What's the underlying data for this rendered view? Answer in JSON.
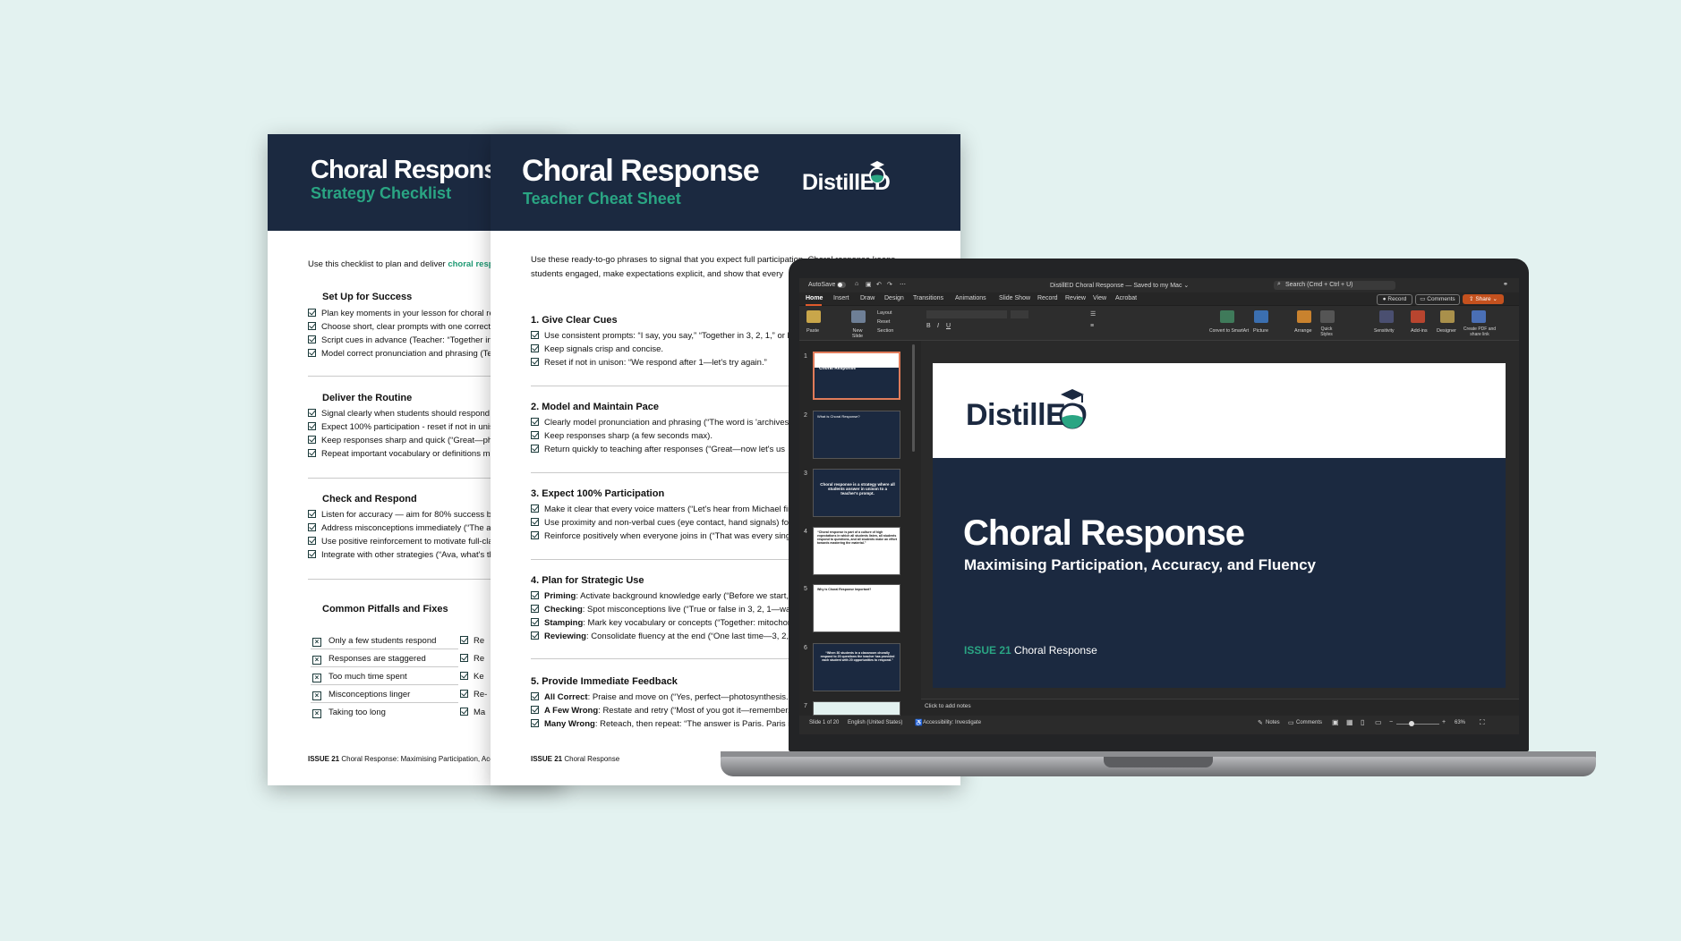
{
  "checklist": {
    "title": "Choral Respons",
    "subtitle": "Strategy Checklist",
    "intro_a": "Use this checklist to plan and deliver ",
    "intro_b": "choral resp",
    "sections": [
      {
        "title": "Set Up for Success",
        "items": [
          "Plan key moments in your lesson for choral res",
          "Choose short, clear prompts with one correct",
          "Script cues in advance (Teacher: “Together in 3",
          "Model correct pronunciation and phrasing (Te"
        ]
      },
      {
        "title": "Deliver the Routine",
        "items": [
          "Signal clearly when students should respond (",
          "Expect 100% participation - reset if not in unis",
          "Keep responses sharp and quick (“Great—pho",
          "Repeat important vocabulary or definitions mu"
        ]
      },
      {
        "title": "Check and Respond",
        "items": [
          "Listen for accuracy — aim for 80% success be",
          "Address misconceptions immediately (“The ar",
          "Use positive reinforcement to motivate full-cla",
          "Integrate with other strategies (“Ava, what's the"
        ]
      }
    ],
    "pitfalls_title": "Common Pitfalls and Fixes",
    "pitfalls": [
      "Only a few students respond",
      "Responses are staggered",
      "Too much time spent",
      "Misconceptions linger",
      "Taking too long"
    ],
    "fixes": [
      "Re",
      "Re",
      "Ke",
      "Re-",
      "Ma"
    ],
    "footer_issue": "ISSUE 21",
    "footer_text": "Choral Response: Maximising Participation, Accur"
  },
  "cheatsheet": {
    "title": "Choral Response",
    "subtitle": "Teacher Cheat Sheet",
    "logo": "DistillED",
    "intro_1": "Use these ready-to-go phrases to signal that you expect full participation. Choral response keeps",
    "intro_2": "students engaged, make expectations explicit, and show that every",
    "sections": [
      {
        "title": "1. Give Clear Cues",
        "items": [
          {
            "bold": "",
            "text": "Use consistent prompts: “I say, you say,” “Together in 3, 2, 1,” or hand"
          },
          {
            "bold": "",
            "text": "Keep signals crisp and concise."
          },
          {
            "bold": "",
            "text": "Reset if not in unison: “We respond after 1—let's try again.”"
          }
        ]
      },
      {
        "title": "2. Model and Maintain Pace",
        "items": [
          {
            "bold": "",
            "text": "Clearly model pronunciation and phrasing (“The word is 'archives.' L"
          },
          {
            "bold": "",
            "text": "Keep responses sharp (a few seconds max)."
          },
          {
            "bold": "",
            "text": "Return quickly to teaching after responses (“Great—now let's us"
          }
        ]
      },
      {
        "title": "3. Expect 100% Participation",
        "items": [
          {
            "bold": "",
            "text": "Make it clear that every voice matters (“Let's hear from Michael first."
          },
          {
            "bold": "",
            "text": "Use proximity and non-verbal cues (eye contact, hand signals) for"
          },
          {
            "bold": "",
            "text": "Reinforce positively when everyone joins in (“That was every single"
          }
        ]
      },
      {
        "title": "4. Plan for Strategic Use",
        "items": [
          {
            "bold": "Priming",
            "text": ": Activate background knowledge early (“Before we start, le"
          },
          {
            "bold": "Checking",
            "text": ": Spot misconceptions live (“True or false in 3, 2, 1—water"
          },
          {
            "bold": "Stamping",
            "text": ": Mark key vocabulary or concepts (“Together: mitochon"
          },
          {
            "bold": "Reviewing",
            "text": ": Consolidate fluency at the end (“One last time—3, 2, 1"
          }
        ]
      },
      {
        "title": "5. Provide Immediate Feedback",
        "items": [
          {
            "bold": "All Correct",
            "text": ": Praise and move on (“Yes, perfect—photosynthesis. Le"
          },
          {
            "bold": "A Few Wrong",
            "text": ": Restate and retry (“Most of you got it—remember, it's"
          },
          {
            "bold": "Many Wrong",
            "text": ": Reteach, then repeat: “The answer is Paris. Paris is th"
          }
        ]
      }
    ],
    "footer_issue": "ISSUE 21",
    "footer_text": "Choral Response"
  },
  "ppt": {
    "autosave": "AutoSave",
    "doc_title": "DistillED Choral Response — Saved to my Mac ⌄",
    "search": "Search (Cmd + Ctrl + U)",
    "tabs": [
      "Home",
      "Insert",
      "Draw",
      "Design",
      "Transitions",
      "Animations",
      "Slide Show",
      "Record",
      "Review",
      "View",
      "Acrobat"
    ],
    "record_btn": "Record",
    "comments_btn": "Comments",
    "share_btn": "Share",
    "ribbon": {
      "paste": "Paste",
      "new_slide": "New Slide",
      "layout": "Layout",
      "reset": "Reset",
      "section": "Section",
      "convert": "Convert to SmartArt",
      "picture": "Picture",
      "arrange": "Arrange",
      "quick_styles": "Quick Styles",
      "sensitivity": "Sensitivity",
      "addins": "Add-ins",
      "designer": "Designer",
      "create_pdf": "Create PDF and share link"
    },
    "thumbs": [
      {
        "num": "1",
        "text": "Choral Response"
      },
      {
        "num": "2",
        "text": "What is Choral Response?"
      },
      {
        "num": "3",
        "text": "Choral response is a strategy where all students answer in unison to a teacher's prompt."
      },
      {
        "num": "4",
        "text": "“Choral response is part of a culture of high expectations in which all students listen, all students respond to questions, and all students make an effort towards mastering the material.”"
      },
      {
        "num": "5",
        "text": "Why is Choral Response Important?"
      },
      {
        "num": "6",
        "text": "“When 30 students in a classroom chorally respond to 20 questions the teacher has provided each student with 20 opportunities to respond.”"
      },
      {
        "num": "7",
        "text": ""
      }
    ],
    "slide": {
      "logo": "DistillED",
      "title": "Choral Response",
      "subtitle": "Maximising Participation, Accuracy, and Fluency",
      "issue_label": "ISSUE 21",
      "issue_text": "Choral Response"
    },
    "notes": "Click to add notes",
    "status_slide": "Slide 1 of 20",
    "status_lang": "English (United States)",
    "status_access": "Accessibility: Investigate",
    "status_notes": "Notes",
    "status_comments": "Comments",
    "zoom": "63%"
  }
}
